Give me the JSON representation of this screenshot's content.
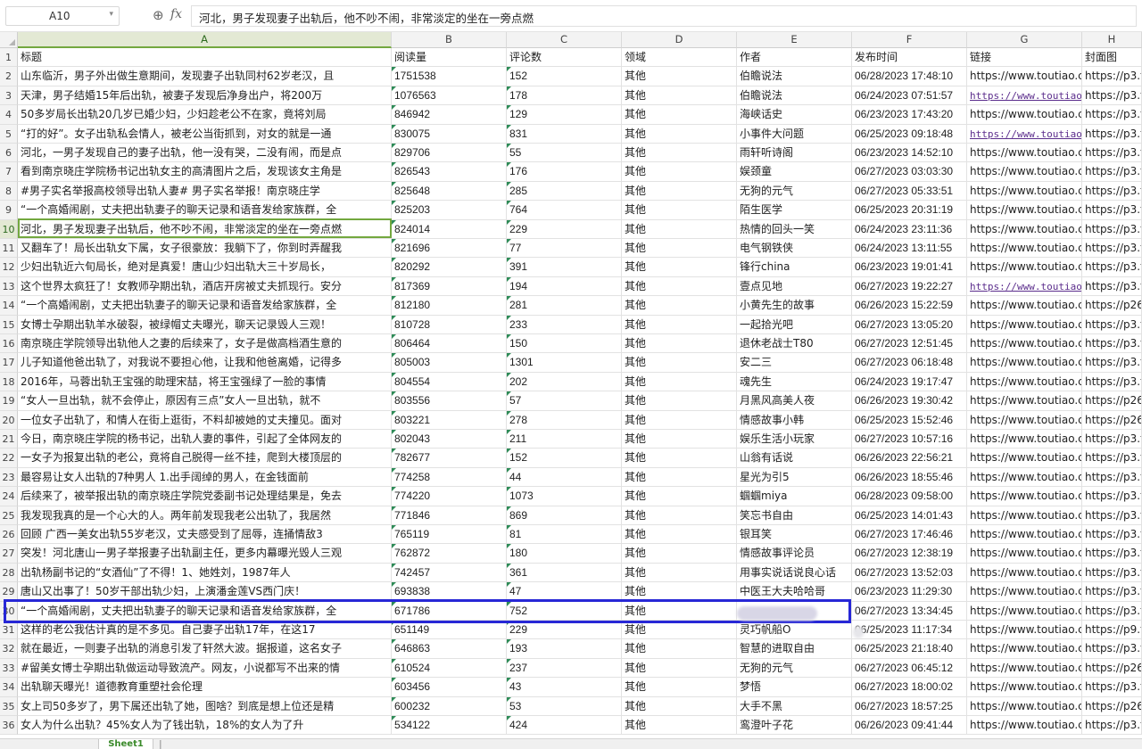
{
  "formula_bar": {
    "cell_ref": "A10",
    "fx_label": "fx",
    "content": "河北，男子发现妻子出轨后，他不吵不闹，非常淡定的坐在一旁点燃"
  },
  "columns": [
    "A",
    "B",
    "C",
    "D",
    "E",
    "F",
    "G",
    "H"
  ],
  "active_column": "A",
  "active_row": "10",
  "highlighted_row": "30",
  "rows": [
    {
      "n": "1",
      "c": [
        "标题",
        "阅读量",
        "评论数",
        "领域",
        "作者",
        "发布时间",
        "链接",
        "封面图"
      ]
    },
    {
      "n": "2",
      "c": [
        "山东临沂，男子外出做生意期间，发现妻子出轨同村62岁老汉，且",
        "1751538",
        "152",
        "其他",
        "伯瞻说法",
        "06/28/2023 17:48:10",
        "https://www.toutiao.com/",
        "https://p3.to"
      ]
    },
    {
      "n": "3",
      "c": [
        "天津，男子结婚15年后出轨，被妻子发现后净身出户，将200万",
        "1076563",
        "178",
        "其他",
        "伯瞻说法",
        "06/24/2023 07:51:57",
        "https://www.toutiao.",
        "https://p3.to"
      ]
    },
    {
      "n": "4",
      "c": [
        "50多岁局长出轨20几岁已婚少妇，少妇趁老公不在家，竟将刘局",
        "846942",
        "129",
        "其他",
        "海峡话史",
        "06/23/2023 17:43:20",
        "https://www.toutiao.com/",
        "https://p3.to"
      ]
    },
    {
      "n": "5",
      "c": [
        "“打的好”。女子出轨私会情人，被老公当街抓到，对女的就是一通",
        "830075",
        "831",
        "其他",
        "小事件大问题",
        "06/25/2023 09:18:48",
        "https://www.toutiao.",
        "https://p3.to"
      ]
    },
    {
      "n": "6",
      "c": [
        "河北，一男子发现自己的妻子出轨，他一没有哭，二没有闹，而是点",
        "829706",
        "55",
        "其他",
        "雨轩听诗阁",
        "06/23/2023 14:52:10",
        "https://www.toutiao.com/",
        "https://p3.to"
      ]
    },
    {
      "n": "7",
      "c": [
        "看到南京晓庄学院杨书记出轨女主的高清图片之后，发现该女主角是",
        "826543",
        "176",
        "其他",
        "娱颈童",
        "06/27/2023 03:03:30",
        "https://www.toutiao.com/",
        "https://p3.to"
      ]
    },
    {
      "n": "8",
      "c": [
        "#男子实名举报高校领导出轨人妻# 男子实名举报！南京晓庄学",
        "825648",
        "285",
        "其他",
        "无狗的元气",
        "06/27/2023 05:33:51",
        "https://www.toutiao.com/",
        "https://p3.to"
      ]
    },
    {
      "n": "9",
      "c": [
        "“一个高婚闹剧，丈夫把出轨妻子的聊天记录和语音发给家族群，全",
        "825203",
        "764",
        "其他",
        "陌生医学",
        "06/25/2023 20:31:19",
        "https://www.toutiao.com/",
        "https://p3.to"
      ]
    },
    {
      "n": "10",
      "c": [
        "河北，男子发现妻子出轨后，他不吵不闹，非常淡定的坐在一旁点燃",
        "824014",
        "229",
        "其他",
        "热情的回头一笑",
        "06/24/2023 23:11:36",
        "https://www.toutiao.com/",
        "https://p3.to"
      ]
    },
    {
      "n": "11",
      "c": [
        "又翻车了！局长出轨女下属，女子很豪放：我躺下了，你到时弄醒我",
        "821696",
        "77",
        "其他",
        "电气钢铁侠",
        "06/24/2023 13:11:55",
        "https://www.toutiao.com/",
        "https://p3.to"
      ]
    },
    {
      "n": "12",
      "c": [
        "少妇出轨近六旬局长，绝对是真爱！唐山少妇出轨大三十岁局长，",
        "820292",
        "391",
        "其他",
        "锋行china",
        "06/23/2023 19:01:41",
        "https://www.toutiao.com/",
        "https://p3.to"
      ]
    },
    {
      "n": "13",
      "c": [
        "这个世界太疯狂了！女教师孕期出轨，酒店开房被丈夫抓现行。安分",
        "817369",
        "194",
        "其他",
        "壹点见地",
        "06/27/2023 19:22:27",
        "https://www.toutiao.",
        "https://p3.to"
      ]
    },
    {
      "n": "14",
      "c": [
        "“一个高婚闹剧，丈夫把出轨妻子的聊天记录和语音发给家族群，全",
        "812180",
        "281",
        "其他",
        "小黄先生的故事",
        "06/26/2023 15:22:59",
        "https://www.toutiao.com/",
        "https://p26.t"
      ]
    },
    {
      "n": "15",
      "c": [
        "女博士孕期出轨羊水破裂，被绿帽丈夫曝光，聊天记录毁人三观！",
        "810728",
        "233",
        "其他",
        "一起拾光吧",
        "06/27/2023 13:05:20",
        "https://www.toutiao.com/",
        "https://p3.to"
      ]
    },
    {
      "n": "16",
      "c": [
        "南京晓庄学院领导出轨他人之妻的后续来了，女子是做高档酒生意的",
        "806464",
        "150",
        "其他",
        "退休老战士T80",
        "06/27/2023 12:51:45",
        "https://www.toutiao.com/",
        "https://p3.to"
      ]
    },
    {
      "n": "17",
      "c": [
        "儿子知道他爸出轨了，对我说不要担心他，让我和他爸离婚，记得多",
        "805003",
        "1301",
        "其他",
        "安二三",
        "06/27/2023 06:18:48",
        "https://www.toutiao.com/",
        "https://p3.to"
      ]
    },
    {
      "n": "18",
      "c": [
        "2016年，马蓉出轨王宝强的助理宋喆，将王宝强绿了一脸的事情",
        "804554",
        "202",
        "其他",
        "魂先生",
        "06/24/2023 19:17:47",
        "https://www.toutiao.com/",
        "https://p3.to"
      ]
    },
    {
      "n": "19",
      "c": [
        "“女人一旦出轨，就不会停止，原因有三点”女人一旦出轨，就不",
        "803556",
        "57",
        "其他",
        "月黑风高美人夜",
        "06/26/2023 19:30:42",
        "https://www.toutiao.com/",
        "https://p26.t"
      ]
    },
    {
      "n": "20",
      "c": [
        "一位女子出轨了，和情人在街上逛街，不料却被她的丈夫撞见。面对",
        "803221",
        "278",
        "其他",
        "情感故事小韩",
        "06/25/2023 15:52:46",
        "https://www.toutiao.com/",
        "https://p26.t"
      ]
    },
    {
      "n": "21",
      "c": [
        "今日，南京晓庄学院的杨书记，出轨人妻的事件，引起了全体网友的",
        "802043",
        "211",
        "其他",
        "娱乐生活小玩家",
        "06/27/2023 10:57:16",
        "https://www.toutiao.com/",
        "https://p3.to"
      ]
    },
    {
      "n": "22",
      "c": [
        "一女子为报复出轨的老公，竟将自己脱得一丝不挂，爬到大楼顶层的",
        "782677",
        "152",
        "其他",
        "山翁有话说",
        "06/26/2023 22:56:21",
        "https://www.toutiao.com/",
        "https://p3.to"
      ]
    },
    {
      "n": "23",
      "c": [
        "最容易让女人出轨的7种男人 1.出手阔绰的男人，在金钱面前",
        "774258",
        "44",
        "其他",
        "星光为引5",
        "06/26/2023 18:55:46",
        "https://www.toutiao.com/",
        "https://p3.to"
      ]
    },
    {
      "n": "24",
      "c": [
        "后续来了，被举报出轨的南京晓庄学院党委副书记处理结果是，免去",
        "774220",
        "1073",
        "其他",
        "蝈蝈miya",
        "06/28/2023 09:58:00",
        "https://www.toutiao.com/",
        "https://p3.to"
      ]
    },
    {
      "n": "25",
      "c": [
        "我发现我真的是一个心大的人。两年前发现我老公出轨了，我居然",
        "771846",
        "869",
        "其他",
        "笑忘书自由",
        "06/25/2023 14:01:43",
        "https://www.toutiao.com/",
        "https://p3.to"
      ]
    },
    {
      "n": "26",
      "c": [
        "回顾 广西一美女出轨55岁老汉，丈夫感受到了屈辱，连捅情敌3",
        "765119",
        "81",
        "其他",
        "银耳笑",
        "06/27/2023 17:46:46",
        "https://www.toutiao.com/",
        "https://p3.to"
      ]
    },
    {
      "n": "27",
      "c": [
        "突发！河北唐山一男子举报妻子出轨副主任，更多内幕曝光毁人三观",
        "762872",
        "180",
        "其他",
        "情感故事评论员",
        "06/27/2023 12:38:19",
        "https://www.toutiao.com/",
        "https://p3.to"
      ]
    },
    {
      "n": "28",
      "c": [
        "出轨杨副书记的“女酒仙”了不得！1、她姓刘，1987年人",
        "742457",
        "361",
        "其他",
        "用事实说话说良心话",
        "06/27/2023 13:52:03",
        "https://www.toutiao.com/",
        "https://p3.to"
      ]
    },
    {
      "n": "29",
      "c": [
        "唐山又出事了！50岁干部出轨少妇，上演潘金莲VS西门庆！",
        "693838",
        "47",
        "其他",
        "中医王大夫哈哈哥",
        "06/23/2023 11:29:30",
        "https://www.toutiao.com/",
        "https://p3.to"
      ]
    },
    {
      "n": "30",
      "c": [
        "“一个高婚闹剧，丈夫把出轨妻子的聊天记录和语音发给家族群，全",
        "671786",
        "752",
        "其他",
        "",
        "06/27/2023 13:34:45",
        "https://www.toutiao.com/",
        "https://p3.to"
      ]
    },
    {
      "n": "31",
      "c": [
        "这样的老公我估计真的是不多见。自己妻子出轨17年，在这17",
        "651149",
        "229",
        "其他",
        "灵巧帆船O",
        "06/25/2023 11:17:34",
        "https://www.toutiao.com/",
        "https://p9.to"
      ]
    },
    {
      "n": "32",
      "c": [
        "就在最近，一则妻子出轨的消息引发了轩然大波。据报道，这名女子",
        "646863",
        "193",
        "其他",
        "智慧的进取自由",
        "06/25/2023 21:18:40",
        "https://www.toutiao.com/",
        "https://p3.to"
      ]
    },
    {
      "n": "33",
      "c": [
        "#留美女博士孕期出轨做运动导致流产。网友，小说都写不出来的情",
        "610524",
        "237",
        "其他",
        "无狗的元气",
        "06/27/2023 06:45:12",
        "https://www.toutiao.com/",
        "https://p26.t"
      ]
    },
    {
      "n": "34",
      "c": [
        "出轨聊天曝光！道德教育重塑社会伦理",
        "603456",
        "43",
        "其他",
        "梦悟",
        "06/27/2023 18:00:02",
        "https://www.toutiao.com/",
        "https://p3.to"
      ]
    },
    {
      "n": "35",
      "c": [
        "女上司50多岁了，男下属还出轨了她，图啥？到底是想上位还是精",
        "600232",
        "53",
        "其他",
        "大手不黑",
        "06/27/2023 18:57:25",
        "https://www.toutiao.com/",
        "https://p26.t"
      ]
    },
    {
      "n": "36",
      "c": [
        "女人为什么出轨？45%女人为了钱出轨，18%的女人为了升",
        "534122",
        "424",
        "其他",
        "鸾澄叶子花",
        "06/26/2023 09:41:44",
        "https://www.toutiao.com/",
        "https://p3.to"
      ]
    }
  ],
  "underlined_link_rows": [
    "3",
    "5",
    "13"
  ],
  "sheet_tab": "Sheet1",
  "colors": {
    "active_header": "#73a83f",
    "highlight_box": "#2727d6",
    "link_visited": "#5b2d8c"
  }
}
